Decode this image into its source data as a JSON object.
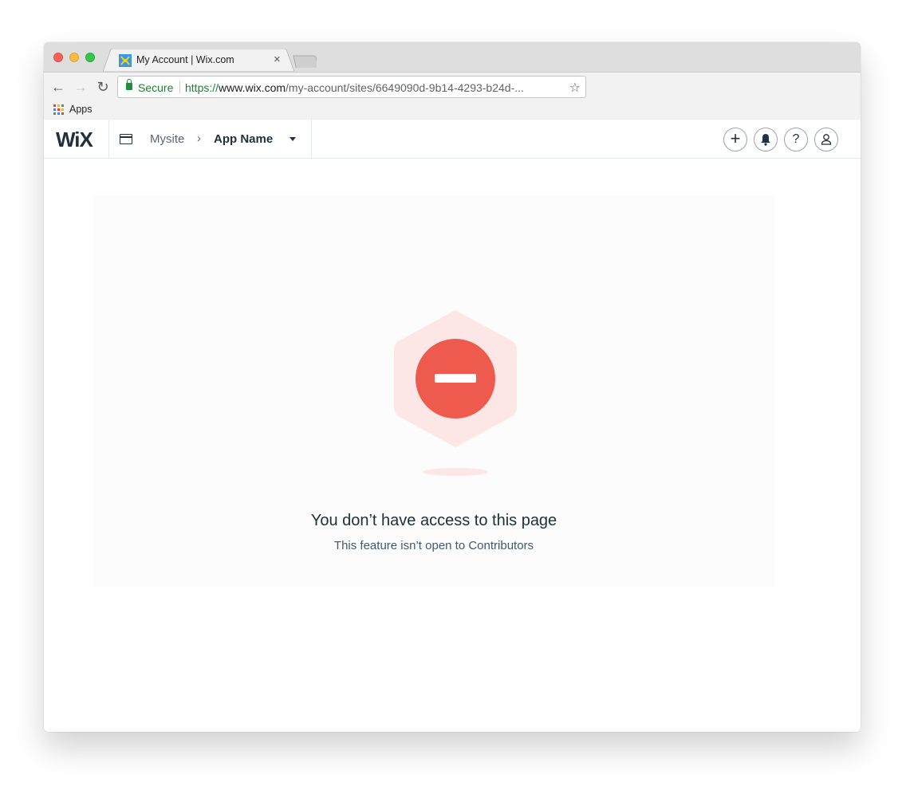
{
  "browser": {
    "tab_title": "My Account | Wix.com",
    "tab_close": "×",
    "secure_label": "Secure",
    "url_scheme": "https://",
    "url_host": "www.wix.com",
    "url_path": "/my-account/sites/6649090d-9b14-4293-b24d-...",
    "bookmark_apps": "Apps",
    "nav": {
      "back": "←",
      "forward": "→",
      "reload": "↻",
      "star": "☆"
    }
  },
  "header": {
    "logo": "WiX",
    "site_name": "Mysite",
    "separator": "›",
    "app_name": "App Name",
    "actions": {
      "add": "+",
      "help": "?"
    }
  },
  "main": {
    "title": "You don’t have access to this page",
    "subtitle": "This feature isn’t open to Contributors"
  },
  "colors": {
    "accent_red": "#ef5a4f",
    "hex_bg": "#fde7e6",
    "text_dark": "#20303c",
    "text_sub": "#3f5a73"
  }
}
